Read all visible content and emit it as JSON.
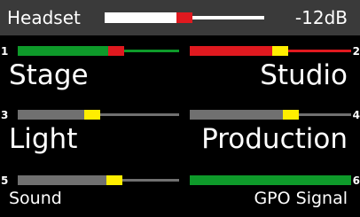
{
  "header": {
    "title": "Headset",
    "value": "-12dB",
    "level": 0.5,
    "colors": {
      "bar": "#3a3a3a",
      "track": "#ffffff",
      "thumb": "#e0191f"
    }
  },
  "channels": [
    {
      "number": "1",
      "label": "Stage",
      "level": 0.62,
      "peak": 0.62,
      "line": "#0e9a2a",
      "fill": "#0e9a2a",
      "peak_color": "#e0191f"
    },
    {
      "number": "2",
      "label": "Studio",
      "level": 0.57,
      "peak": 0.57,
      "line": "#e0191f",
      "fill": "#e0191f",
      "peak_color": "#ffee00"
    },
    {
      "number": "3",
      "label": "Light",
      "level": 0.46,
      "peak": 0.46,
      "line": "#707070",
      "fill": "#707070",
      "peak_color": "#ffee00"
    },
    {
      "number": "4",
      "label": "Production",
      "level": 0.64,
      "peak": 0.64,
      "line": "#707070",
      "fill": "#707070",
      "peak_color": "#ffee00"
    },
    {
      "number": "5",
      "label": "Sound",
      "level": 0.61,
      "peak": 0.61,
      "line": "#707070",
      "fill": "#707070",
      "peak_color": "#ffee00"
    },
    {
      "number": "6",
      "label": "GPO Signal",
      "level": 1.0,
      "peak": null,
      "line": "#0e9a2a",
      "fill": "#0e9a2a",
      "peak_color": null
    }
  ]
}
